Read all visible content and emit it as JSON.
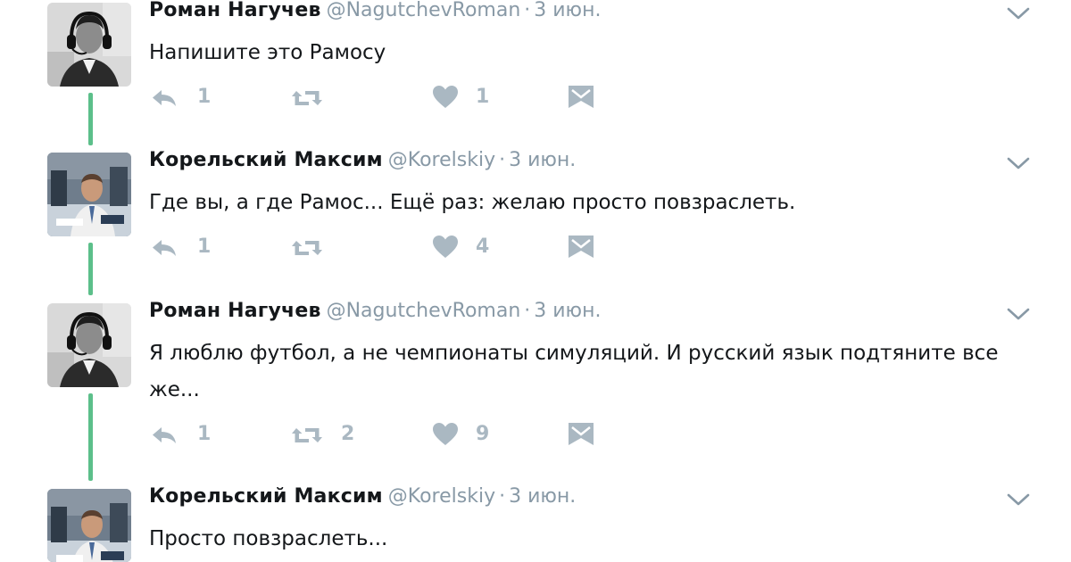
{
  "tweets": [
    {
      "name": "Роман Нагучев",
      "handle": "@NagutchevRoman",
      "separator": "·",
      "time": "3 июн.",
      "text": "Напишите это Рамосу",
      "replies": "1",
      "retweets": "",
      "likes": "1",
      "avatar": "roman-avatar"
    },
    {
      "name": "Корельский Максим",
      "handle": "@Korelskiy",
      "separator": "·",
      "time": "3 июн.",
      "text": "Где вы, а где Рамос... Ещё раз: желаю просто повзраслеть.",
      "replies": "1",
      "retweets": "",
      "likes": "4",
      "avatar": "maxim-avatar"
    },
    {
      "name": "Роман Нагучев",
      "handle": "@NagutchevRoman",
      "separator": "·",
      "time": "3 июн.",
      "text": "Я люблю футбол, а не чемпионаты симуляций. И русский язык подтяните все же...",
      "replies": "1",
      "retweets": "2",
      "likes": "9",
      "avatar": "roman-avatar"
    },
    {
      "name": "Корельский Максим",
      "handle": "@Korelskiy",
      "separator": "·",
      "time": "3 июн.",
      "text": "Просто повзраслеть..."
    }
  ],
  "colors": {
    "thread_line": "#5cbf8a",
    "action_icon": "#aab8c2",
    "meta_text": "#8899a6"
  },
  "icons": [
    "reply-icon",
    "retweet-icon",
    "heart-icon",
    "direct-message-icon",
    "chevron-down-icon"
  ]
}
